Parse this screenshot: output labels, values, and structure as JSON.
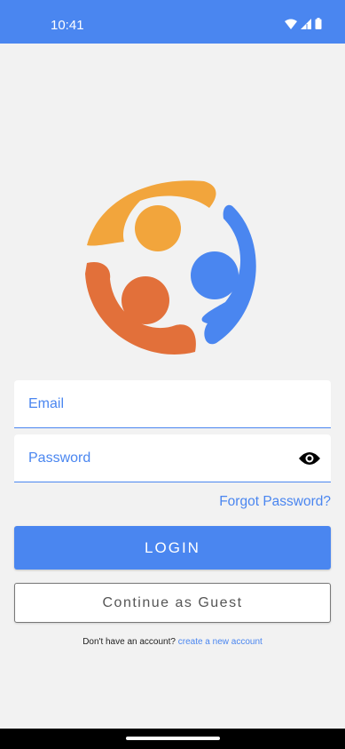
{
  "status_bar": {
    "time": "10:41",
    "icons": [
      "wifi-icon",
      "signal-icon",
      "battery-icon"
    ]
  },
  "logo": {
    "icon": "people-circle-logo",
    "colors": {
      "orange_yellow": "#f2a53c",
      "blue": "#4a86f0",
      "orange_red": "#e2703a"
    }
  },
  "form": {
    "email_placeholder": "Email",
    "password_placeholder": "Password",
    "password_toggle_icon": "eye-icon"
  },
  "forgot_password": "Forgot Password?",
  "buttons": {
    "login": "LOGIN",
    "guest": "Continue as Guest"
  },
  "signup": {
    "prompt": "Don't have an account?",
    "link": "create a new account"
  },
  "colors": {
    "accent": "#4a86f0",
    "background": "#f2f2f2"
  }
}
